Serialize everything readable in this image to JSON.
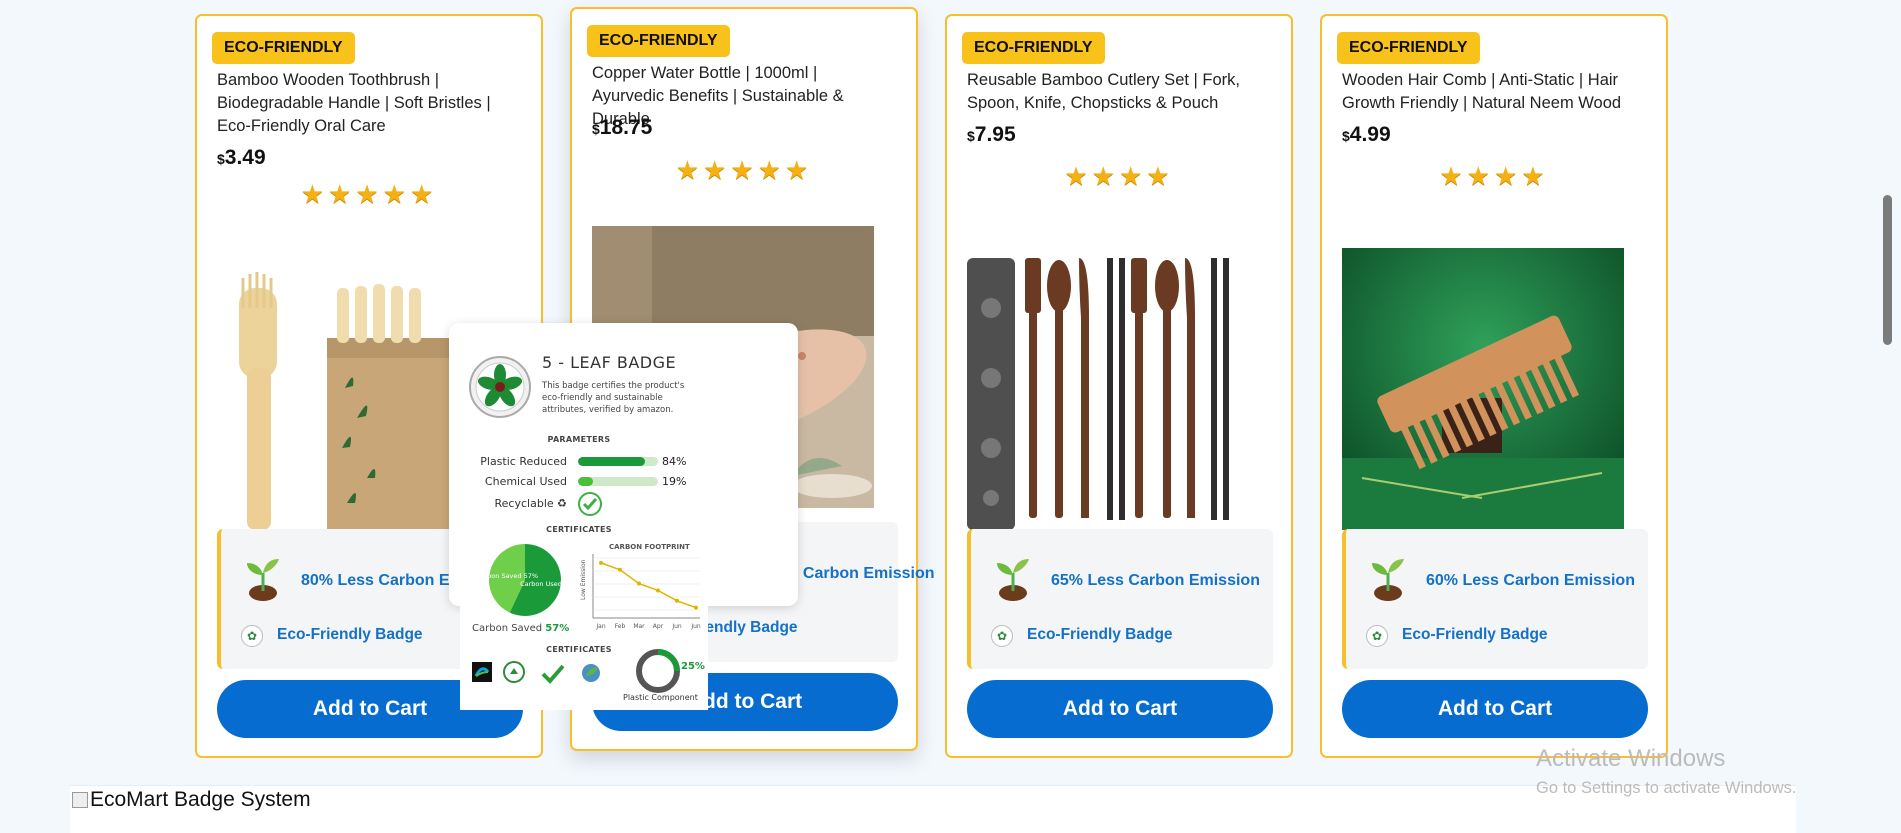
{
  "products": [
    {
      "badge": "ECO-FRIENDLY",
      "title": "Bamboo Wooden Toothbrush | Biodegradable Handle | Soft Bristles | Eco-Friendly Oral Care",
      "currency": "$",
      "price": "3.49",
      "rating": 5,
      "stars": "★★★★★",
      "carbon": "80% Less Carbon Emission",
      "eco_badge": "Eco-Friendly Badge",
      "cta": "Add to Cart"
    },
    {
      "badge": "ECO-FRIENDLY",
      "title": "Copper Water Bottle | 1000ml | Ayurvedic Benefits | Sustainable & Durable",
      "currency": "$",
      "price": "18.75",
      "rating": 5,
      "stars": "★★★★★",
      "carbon": "Less Carbon Emission",
      "eco_badge": "Eco-Friendly Badge",
      "cta": "Add to Cart"
    },
    {
      "badge": "ECO-FRIENDLY",
      "title": "Reusable Bamboo Cutlery Set | Fork, Spoon, Knife, Chopsticks & Pouch",
      "currency": "$",
      "price": "7.95",
      "rating": 4,
      "stars": "★★★★",
      "carbon": "65% Less Carbon Emission",
      "eco_badge": "Eco-Friendly Badge",
      "cta": "Add to Cart"
    },
    {
      "badge": "ECO-FRIENDLY",
      "title": "Wooden Hair Comb | Anti-Static | Hair Growth Friendly | Natural Neem Wood",
      "currency": "$",
      "price": "4.99",
      "rating": 4,
      "stars": "★★★★",
      "carbon": "60% Less Carbon Emission",
      "eco_badge": "Eco-Friendly Badge",
      "cta": "Add to Cart"
    }
  ],
  "badge_popup": {
    "title": "5 - LEAF BADGE",
    "description": "This badge certifies the product's eco-friendly and sustainable attributes, verified by amazon.",
    "parameters_heading": "PARAMETERS",
    "parameters": [
      {
        "label": "Plastic Reduced",
        "value": "84%",
        "fraction": 0.84
      },
      {
        "label": "Chemical Used",
        "value": "19%",
        "fraction": 0.19
      }
    ],
    "recyclable_label": "Recyclable ♻",
    "certificates_heading": "CERTIFICATES",
    "pie": {
      "saved_label": "Carbon Saved 57%",
      "used_label": "Carbon Used",
      "saved_fraction": 0.57
    },
    "carbon_saved_text": "Carbon Saved",
    "carbon_saved_value": "57%",
    "footprint": {
      "title": "CARBON FOOTPRINT",
      "ylabel": "Low Emission",
      "months": [
        "Jan",
        "Feb",
        "Mar",
        "Apr",
        "Jun",
        "Jun"
      ],
      "values": [
        8,
        7,
        5,
        4,
        2.5,
        1.5
      ]
    },
    "certificates_heading_2": "CERTIFICATES",
    "plastic_component_value": "25%",
    "plastic_component_label": "Plastic Component",
    "plastic_component_fraction": 0.25
  },
  "footer_image_alt": "EcoMart Badge System",
  "windows_watermark": {
    "line1": "Activate Windows",
    "line2": "Go to Settings to activate Windows."
  },
  "colors": {
    "accent_yellow": "#f9c21a",
    "button_blue": "#066ccf",
    "link_blue": "#1471c6",
    "eco_green": "#1b9a3a"
  }
}
